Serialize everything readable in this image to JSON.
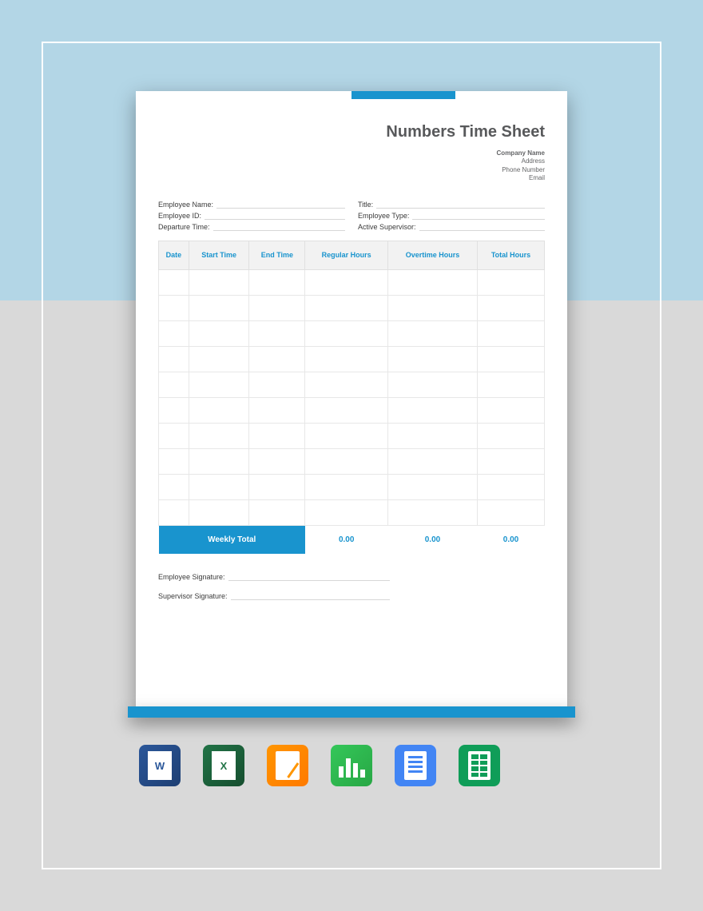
{
  "header": {
    "title": "Numbers Time Sheet",
    "company_name": "Company Name",
    "address": "Address",
    "phone": "Phone Number",
    "email": "Email"
  },
  "fields": {
    "employee_name": "Employee Name:",
    "employee_id": "Employee ID:",
    "departure_time": "Departure Time:",
    "title": "Title:",
    "employee_type": "Employee Type:",
    "active_supervisor": "Active Supervisor:"
  },
  "table": {
    "headers": {
      "date": "Date",
      "start_time": "Start Time",
      "end_time": "End Time",
      "regular_hours": "Regular Hours",
      "overtime_hours": "Overtime Hours",
      "total_hours": "Total Hours"
    },
    "row_count": 10,
    "weekly_total_label": "Weekly Total",
    "totals": {
      "regular": "0.00",
      "overtime": "0.00",
      "total": "0.00"
    }
  },
  "signatures": {
    "employee": "Employee Signature:",
    "supervisor": "Supervisor Signature:"
  },
  "icons": {
    "word": "W",
    "excel": "X"
  }
}
